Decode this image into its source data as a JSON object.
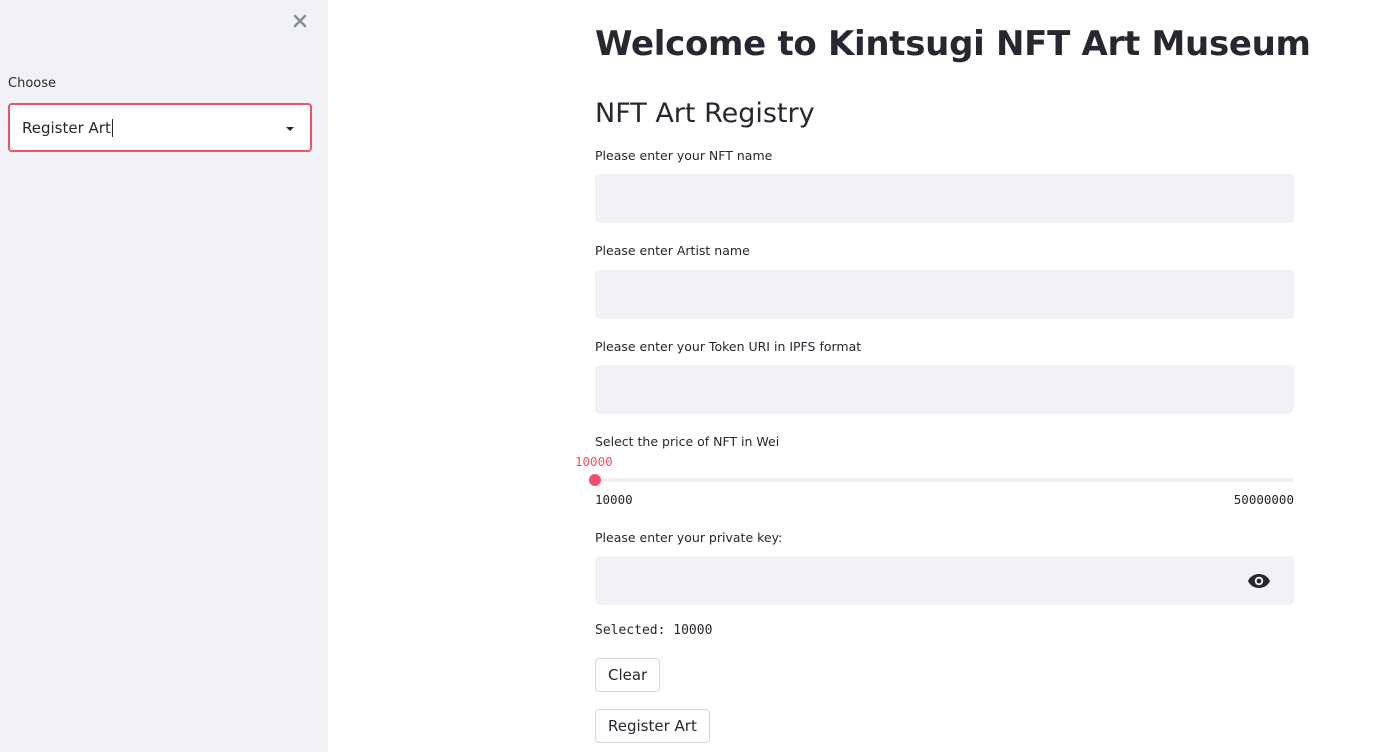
{
  "sidebar": {
    "close_icon": "close-icon",
    "choose_label": "Choose",
    "select_value": "Register Art",
    "accent_color": "#f0506e",
    "background_color": "#f0f2f6"
  },
  "main": {
    "title": "Welcome to Kintsugi NFT Art Museum",
    "section_title": "NFT Art Registry",
    "fields": {
      "nft_name_label": "Please enter your NFT name",
      "artist_name_label": "Please enter Artist name",
      "token_uri_label": "Please enter your Token URI in IPFS format",
      "price_label": "Select the price of NFT in Wei",
      "private_key_label": "Please enter your private key:"
    },
    "inputs": {
      "nft_name_value": "",
      "artist_name_value": "",
      "token_uri_value": "",
      "private_key_value": ""
    },
    "slider": {
      "current_value": "10000",
      "min": "10000",
      "max": "50000000",
      "position_fraction": 0
    },
    "selected_text": "Selected: 10000",
    "buttons": {
      "clear": "Clear",
      "register": "Register Art"
    },
    "password_toggle_icon": "eye-icon"
  }
}
